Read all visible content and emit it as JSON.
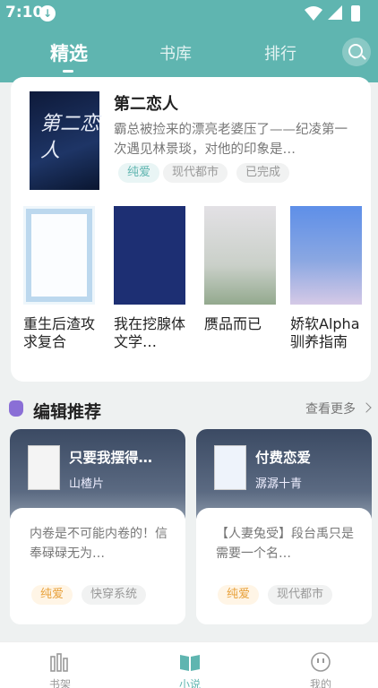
{
  "status_bar": {
    "time": "7:10"
  },
  "header": {
    "tabs": [
      {
        "label": "精选"
      },
      {
        "label": "书库"
      },
      {
        "label": "排行"
      }
    ]
  },
  "featured": {
    "title": "第二恋人",
    "description": "霸总被捡来的漂亮老婆压了——纪凌第一次遇见林景琰，对他的印象是…",
    "tags": [
      "纯爱",
      "现代都市",
      "已完成"
    ],
    "cover_text": "第二恋人"
  },
  "books": [
    {
      "name": "重生后渣攻求复合"
    },
    {
      "name": "我在挖腺体文学…"
    },
    {
      "name": "赝品而已"
    },
    {
      "name": "娇软Alpha驯养指南"
    }
  ],
  "editor": {
    "title": "编辑推荐",
    "more": "查看更多",
    "items": [
      {
        "title": "只要我摆得…",
        "author": "山楂片",
        "desc": "内卷是不可能内卷的！信奉碌碌无为…",
        "tags": [
          "纯爱",
          "快穿系统"
        ]
      },
      {
        "title": "付费恋爱",
        "author": "潺潺十青",
        "desc": "【人妻兔受】段台禹只是需要一个名…",
        "tags": [
          "纯爱",
          "现代都市"
        ]
      }
    ]
  },
  "nav": {
    "items": [
      {
        "label": "书架"
      },
      {
        "label": "小说"
      },
      {
        "label": "我的"
      }
    ]
  },
  "colors": {
    "brand": "#5fb5b0",
    "accent_orange": "#e8a13b"
  }
}
